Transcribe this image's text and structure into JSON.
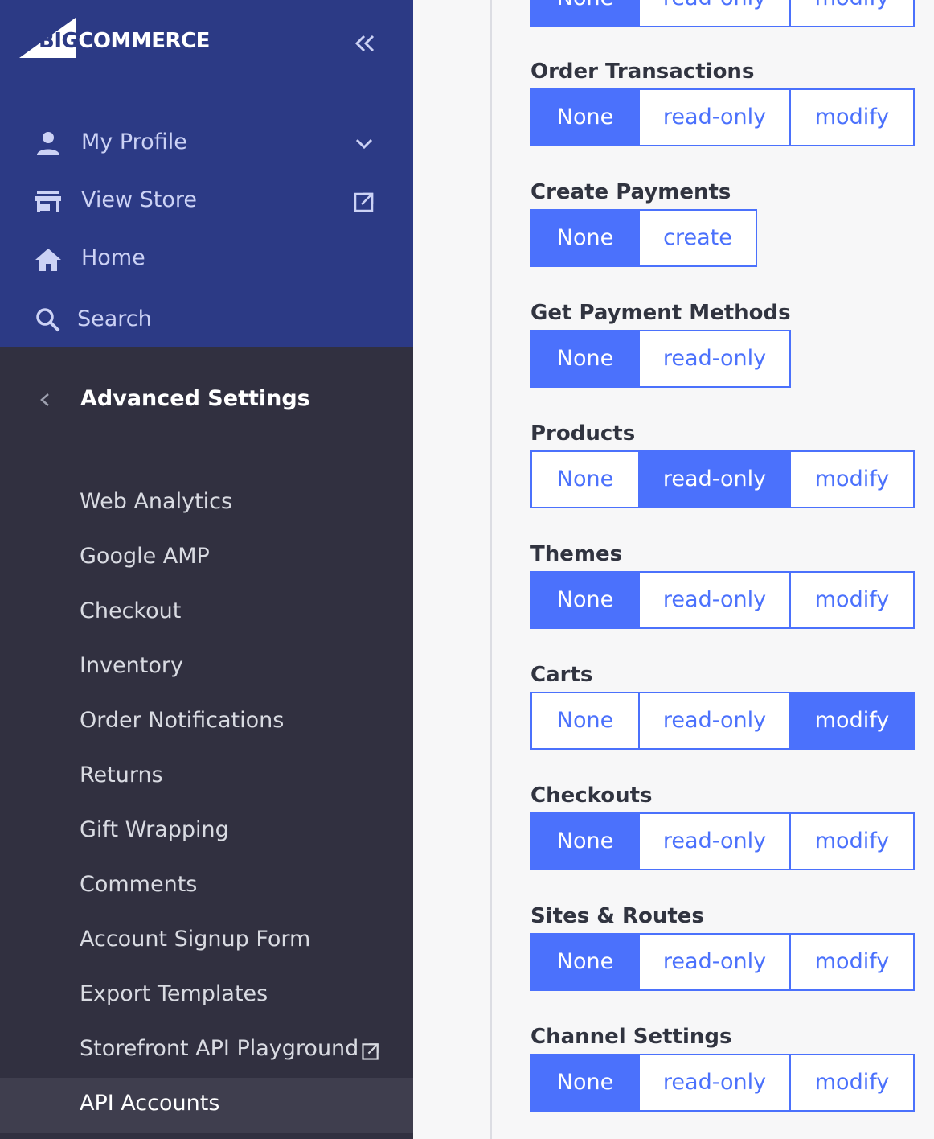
{
  "sidebar": {
    "logo": {
      "big": "BIG",
      "rest": "COMMERCE"
    },
    "collapse_icon": "double-chevron-left-icon",
    "nav": [
      {
        "label": "My Profile",
        "icon": "user-icon",
        "trail": "chevron-down-icon"
      },
      {
        "label": "View Store",
        "icon": "store-icon",
        "trail": "external-link-icon"
      },
      {
        "label": "Home",
        "icon": "home-icon"
      },
      {
        "label": "Search",
        "icon": "search-icon"
      }
    ],
    "section_title": "Advanced Settings",
    "sub_items": [
      {
        "label": "Web Analytics"
      },
      {
        "label": "Google AMP"
      },
      {
        "label": "Checkout"
      },
      {
        "label": "Inventory"
      },
      {
        "label": "Order Notifications"
      },
      {
        "label": "Returns"
      },
      {
        "label": "Gift Wrapping"
      },
      {
        "label": "Comments"
      },
      {
        "label": "Account Signup Form"
      },
      {
        "label": "Export Templates"
      },
      {
        "label": "Storefront API Playground",
        "external": true
      },
      {
        "label": "API Accounts",
        "active": true
      }
    ]
  },
  "permissions": [
    {
      "title": "",
      "options": [
        "None",
        "read-only",
        "modify"
      ],
      "selected": "None"
    },
    {
      "title": "Order Transactions",
      "options": [
        "None",
        "read-only",
        "modify"
      ],
      "selected": "None"
    },
    {
      "title": "Create Payments",
      "options": [
        "None",
        "create"
      ],
      "selected": "None"
    },
    {
      "title": "Get Payment Methods",
      "options": [
        "None",
        "read-only"
      ],
      "selected": "None"
    },
    {
      "title": "Products",
      "options": [
        "None",
        "read-only",
        "modify"
      ],
      "selected": "read-only"
    },
    {
      "title": "Themes",
      "options": [
        "None",
        "read-only",
        "modify"
      ],
      "selected": "None"
    },
    {
      "title": "Carts",
      "options": [
        "None",
        "read-only",
        "modify"
      ],
      "selected": "modify"
    },
    {
      "title": "Checkouts",
      "options": [
        "None",
        "read-only",
        "modify"
      ],
      "selected": "None"
    },
    {
      "title": "Sites & Routes",
      "options": [
        "None",
        "read-only",
        "modify"
      ],
      "selected": "None"
    },
    {
      "title": "Channel Settings",
      "options": [
        "None",
        "read-only",
        "modify"
      ],
      "selected": "None"
    }
  ],
  "colors": {
    "sidebar_top": "#2c3a85",
    "sidebar_dark": "#313040",
    "accent": "#4b71fc"
  }
}
